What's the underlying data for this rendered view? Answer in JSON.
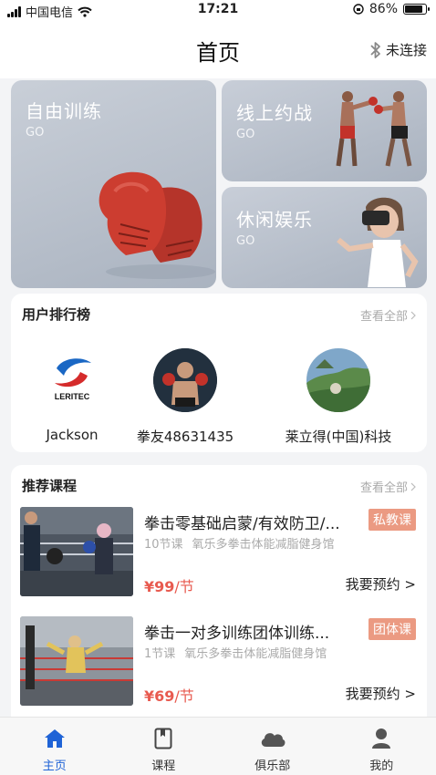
{
  "status_bar": {
    "carrier": "中国电信",
    "time": "17:21",
    "battery": "86%",
    "battery_level": 0.86
  },
  "header": {
    "title": "首页",
    "bluetooth_status": "未连接"
  },
  "banners": [
    {
      "title": "自由训练",
      "go": "GO"
    },
    {
      "title": "线上约战",
      "go": "GO"
    },
    {
      "title": "休闲娱乐",
      "go": "GO"
    }
  ],
  "ranking": {
    "title": "用户排行榜",
    "see_all": "查看全部",
    "users": [
      {
        "name": "Jackson",
        "logo_text": "LERITEC"
      },
      {
        "name": "拳友48631435"
      },
      {
        "name": "莱立得(中国)科技"
      }
    ]
  },
  "courses": {
    "title": "推荐课程",
    "see_all": "查看全部",
    "items": [
      {
        "title": "拳击零基础启蒙/有效防卫/...",
        "tag": "私教课",
        "lessons": "10节课",
        "venue": "氧乐多拳击体能减脂健身馆",
        "price": "¥99",
        "unit": "/节",
        "book": "我要预约 >"
      },
      {
        "title": "拳击一对多训练团体训练...",
        "tag": "团体课",
        "lessons": "1节课",
        "venue": "氧乐多拳击体能减脂健身馆",
        "price": "¥69",
        "unit": "/节",
        "book": "我要预约 >"
      }
    ]
  },
  "bottom_nav": [
    {
      "label": "主页",
      "icon": "home-icon",
      "active": true
    },
    {
      "label": "课程",
      "icon": "book-icon",
      "active": false
    },
    {
      "label": "俱乐部",
      "icon": "cloud-icon",
      "active": false
    },
    {
      "label": "我的",
      "icon": "user-icon",
      "active": false
    }
  ],
  "colors": {
    "accent": "#1f63d6",
    "price": "#e85a4f",
    "tag": "#eb9a82"
  }
}
